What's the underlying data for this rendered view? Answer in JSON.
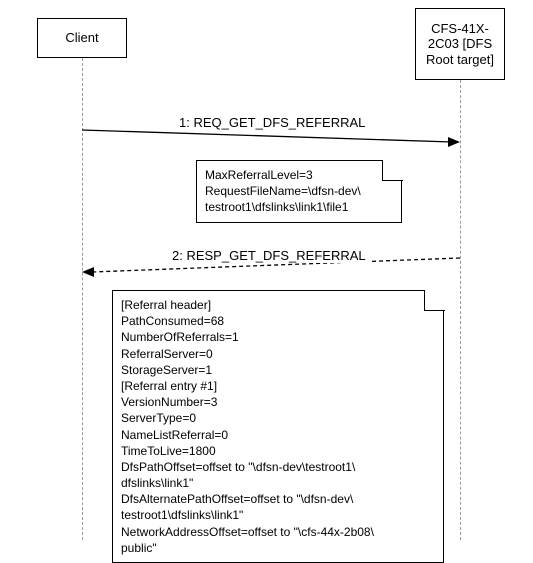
{
  "actors": {
    "client": "Client",
    "server": "CFS-41X-2C03 [DFS Root target]"
  },
  "messages": {
    "m1": "1: REQ_GET_DFS_REFERRAL",
    "m2": "2: RESP_GET_DFS_REFERRAL"
  },
  "note1": {
    "l0": "MaxReferralLevel=3",
    "l1": "RequestFileName=\\dfsn-dev\\",
    "l2": "testroot1\\dfslinks\\link1\\file1"
  },
  "note2": {
    "l0": "[Referral header]",
    "l1": "PathConsumed=68",
    "l2": "NumberOfReferrals=1",
    "l3": "ReferralServer=0",
    "l4": "StorageServer=1",
    "l5": "[Referral entry #1]",
    "l6": "VersionNumber=3",
    "l7": "ServerType=0",
    "l8": "NameListReferral=0",
    "l9": "TimeToLive=1800",
    "l10": "DfsPathOffset=offset to \"\\dfsn-dev\\testroot1\\",
    "l11": "dfslinks\\link1\"",
    "l12": "DfsAlternatePathOffset=offset to \"\\dfsn-dev\\",
    "l13": "testroot1\\dfslinks\\link1\"",
    "l14": "NetworkAddressOffset=offset to \"\\cfs-44x-2b08\\",
    "l15": "public\""
  },
  "chart_data": {
    "type": "uml-sequence",
    "lifelines": [
      {
        "id": "client",
        "label": "Client"
      },
      {
        "id": "server",
        "label": "CFS-41X-2C03 [DFS Root target]"
      }
    ],
    "messages": [
      {
        "from": "client",
        "to": "server",
        "label": "1: REQ_GET_DFS_REFERRAL",
        "style": "solid",
        "note": [
          "MaxReferralLevel=3",
          "RequestFileName=\\dfsn-dev\\testroot1\\dfslinks\\link1\\file1"
        ]
      },
      {
        "from": "server",
        "to": "client",
        "label": "2: RESP_GET_DFS_REFERRAL",
        "style": "dashed",
        "note": [
          "[Referral header]",
          "PathConsumed=68",
          "NumberOfReferrals=1",
          "ReferralServer=0",
          "StorageServer=1",
          "[Referral entry #1]",
          "VersionNumber=3",
          "ServerType=0",
          "NameListReferral=0",
          "TimeToLive=1800",
          "DfsPathOffset=offset to \"\\dfsn-dev\\testroot1\\dfslinks\\link1\"",
          "DfsAlternatePathOffset=offset to \"\\dfsn-dev\\testroot1\\dfslinks\\link1\"",
          "NetworkAddressOffset=offset to \"\\cfs-44x-2b08\\public\""
        ]
      }
    ]
  }
}
